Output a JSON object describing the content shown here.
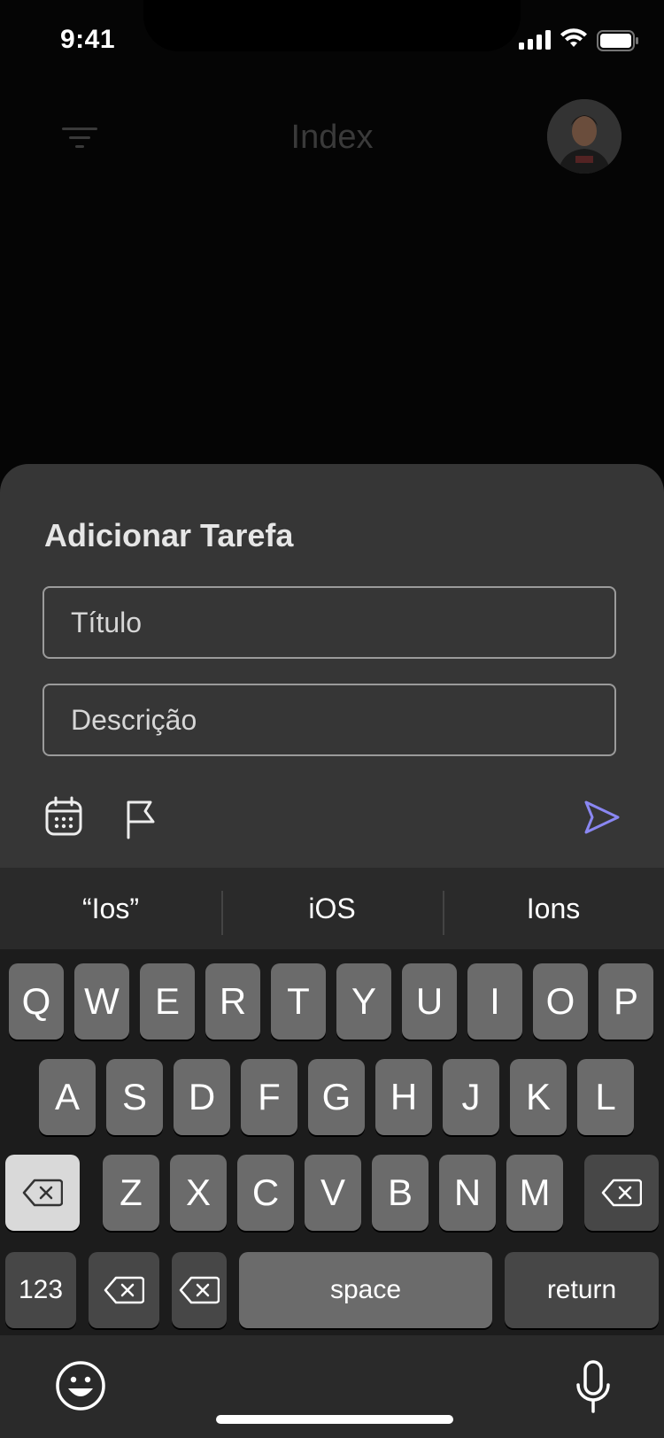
{
  "status_bar": {
    "time": "9:41"
  },
  "header": {
    "title": "Index"
  },
  "sheet": {
    "title": "Adicionar Tarefa",
    "title_placeholder": "Título",
    "description_placeholder": "Descrição",
    "accent_color": "#8A87F2"
  },
  "keyboard": {
    "suggestions": [
      "“Ios”",
      "iOS",
      "Ions"
    ],
    "row1": [
      "Q",
      "W",
      "E",
      "R",
      "T",
      "Y",
      "U",
      "I",
      "O",
      "P"
    ],
    "row2": [
      "A",
      "S",
      "D",
      "F",
      "G",
      "H",
      "J",
      "K",
      "L"
    ],
    "row3": [
      "Z",
      "X",
      "C",
      "V",
      "B",
      "N",
      "M"
    ],
    "numbers_label": "123",
    "space_label": "space",
    "return_label": "return"
  },
  "icons": [
    "signal-icon",
    "wifi-icon",
    "battery-icon",
    "filter-icon",
    "calendar-icon",
    "flag-icon",
    "send-icon",
    "delete-icon",
    "emoji-icon",
    "microphone-icon"
  ]
}
